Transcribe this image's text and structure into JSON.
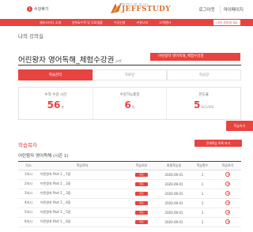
{
  "header": {
    "badge_count": "1",
    "badge_label": "수강후기",
    "logo_tagline": "영어를 읽어주는 영어 · 제프스터디",
    "logo_name": "JEFFSTUDY",
    "links": [
      "로그아웃",
      "마이페이지"
    ]
  },
  "nav": {
    "items": [
      "제프스터디 소개",
      "영어&수학 및 무료샘플",
      "수강신청",
      "커뮤니티",
      "고객센터"
    ],
    "cta": "나의 강의실 Go"
  },
  "page": {
    "title": "나의 강의실",
    "course_select_value": "어린왕자 영어독해_체험수강권"
  },
  "course": {
    "title": "어린왕자 영어독해_체험수강권",
    "sub": "Jeff"
  },
  "tabs": [
    {
      "label": "학습관리",
      "active": true
    },
    {
      "label": "자료방",
      "active": false
    },
    {
      "label": "학습장",
      "active": false
    }
  ],
  "stats": [
    {
      "label": "누적 수강 시간",
      "value": "56",
      "unit": "분"
    },
    {
      "label": "수강가능총일",
      "value": "6",
      "unit": "일"
    },
    {
      "label": "진도율",
      "value": "5",
      "unit": "%(1/20)"
    }
  ],
  "study_button": "학습하기",
  "section": {
    "title": "학습목차",
    "all_button": "전체학습 목록 보기",
    "subtitle": "어린왕자 영어독해 (시즌 1)"
  },
  "table": {
    "headers": [
      "차시",
      "학습목차",
      "학습여부",
      "최종학습일",
      "학습횟수",
      "학습하기"
    ],
    "rows": [
      {
        "no": "1차시",
        "name": "어린왕자 Part 1 _ 1장",
        "status": "완료",
        "date": "2020.09.01",
        "count": "1"
      },
      {
        "no": "2차시",
        "name": "어린왕자 Part 1 _ 2장",
        "status": "완료",
        "date": "2020.09.01",
        "count": "1"
      },
      {
        "no": "3차시",
        "name": "어린왕자 Part 1 _ 3장",
        "status": "완료",
        "date": "2020.09.01",
        "count": "1"
      },
      {
        "no": "4차시",
        "name": "어린왕자 Part 1 _ 4장",
        "status": "완료",
        "date": "2020.09.01",
        "count": "1"
      },
      {
        "no": "5차시",
        "name": "어린왕자 Part 1 _ 5장",
        "status": "완료",
        "date": "2020.09.01",
        "count": "1"
      },
      {
        "no": "6차시",
        "name": "어린왕자 Part 1 _ 6장",
        "status": "완료",
        "date": "2020.09.01",
        "count": "1"
      }
    ]
  },
  "colors": {
    "accent": "#e8433f",
    "logo": "#d9732b"
  }
}
